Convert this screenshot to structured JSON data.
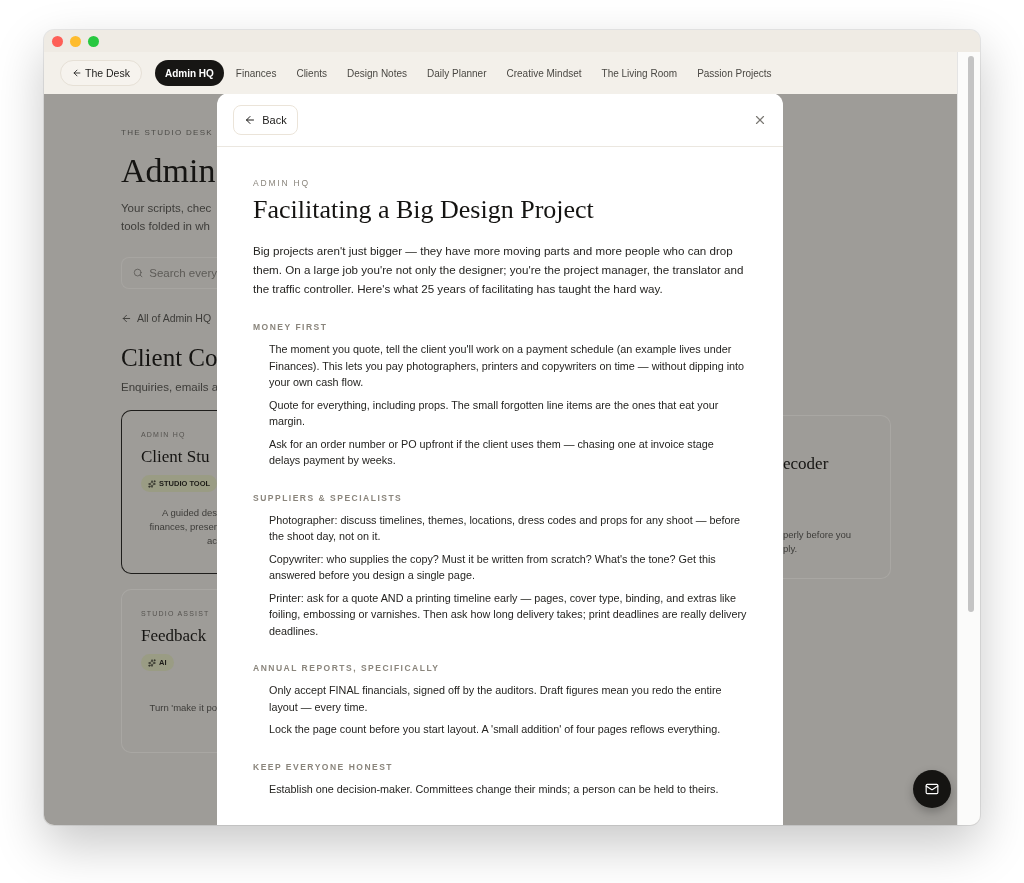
{
  "nav": {
    "home_button": "The Desk",
    "tabs": [
      {
        "label": "Admin HQ",
        "selected": true
      },
      {
        "label": "Finances",
        "selected": false
      },
      {
        "label": "Clients",
        "selected": false
      },
      {
        "label": "Design Notes",
        "selected": false
      },
      {
        "label": "Daily Planner",
        "selected": false
      },
      {
        "label": "Creative Mindset",
        "selected": false
      },
      {
        "label": "The Living Room",
        "selected": false
      },
      {
        "label": "Passion Projects",
        "selected": false
      }
    ]
  },
  "background": {
    "eyebrow": "THE STUDIO DESK",
    "title": "Admin",
    "intro": [
      "Your scripts, chec",
      "tools folded in wh"
    ],
    "search_placeholder": "Search every",
    "back_link": "All of Admin HQ",
    "section_title": "Client Co",
    "section_intro": "Enquiries, emails a",
    "cards": [
      {
        "eyebrow": "ADMIN HQ",
        "title": "Client Stu",
        "badge": "STUDIO TOOL",
        "lines": [
          "A guided des",
          "finances, preser",
          "ac"
        ],
        "selected": true
      },
      {
        "eyebrow": "STUDIO ASSIST",
        "title": "Feedback",
        "badge": "AI",
        "lines": [
          "Turn 'make it po"
        ],
        "selected": false
      }
    ],
    "right_card": {
      "title": "ecoder",
      "lines": [
        "perly before you",
        "ply."
      ]
    }
  },
  "modal": {
    "back_button": "Back",
    "eyebrow": "ADMIN HQ",
    "title": "Facilitating a Big Design Project",
    "intro": "Big projects aren't just bigger — they have more moving parts and more people who can drop them. On a large job you're not only the designer; you're the project manager, the translator and the traffic controller. Here's what 25 years of facilitating has taught the hard way.",
    "sections": [
      {
        "heading": "MONEY FIRST",
        "items": [
          "The moment you quote, tell the client you'll work on a payment schedule (an example lives under Finances). This lets you pay photographers, printers and copywriters on time — without dipping into your own cash flow.",
          "Quote for everything, including props. The small forgotten line items are the ones that eat your margin.",
          "Ask for an order number or PO upfront if the client uses them — chasing one at invoice stage delays payment by weeks."
        ]
      },
      {
        "heading": "SUPPLIERS & SPECIALISTS",
        "items": [
          "Photographer: discuss timelines, themes, locations, dress codes and props for any shoot — before the shoot day, not on it.",
          "Copywriter: who supplies the copy? Must it be written from scratch? What's the tone? Get this answered before you design a single page.",
          "Printer: ask for a quote AND a printing timeline early — pages, cover type, binding, and extras like foiling, embossing or varnishes. Then ask how long delivery takes; print deadlines are really delivery deadlines."
        ]
      },
      {
        "heading": "ANNUAL REPORTS, SPECIFICALLY",
        "items": [
          "Only accept FINAL financials, signed off by the auditors. Draft figures mean you redo the entire layout — every time.",
          "Lock the page count before you start layout. A 'small addition' of four pages reflows everything."
        ]
      },
      {
        "heading": "KEEP EVERYONE HONEST",
        "items": [
          "Establish one decision-maker. Committees change their minds; a person can be held to theirs."
        ]
      }
    ]
  }
}
